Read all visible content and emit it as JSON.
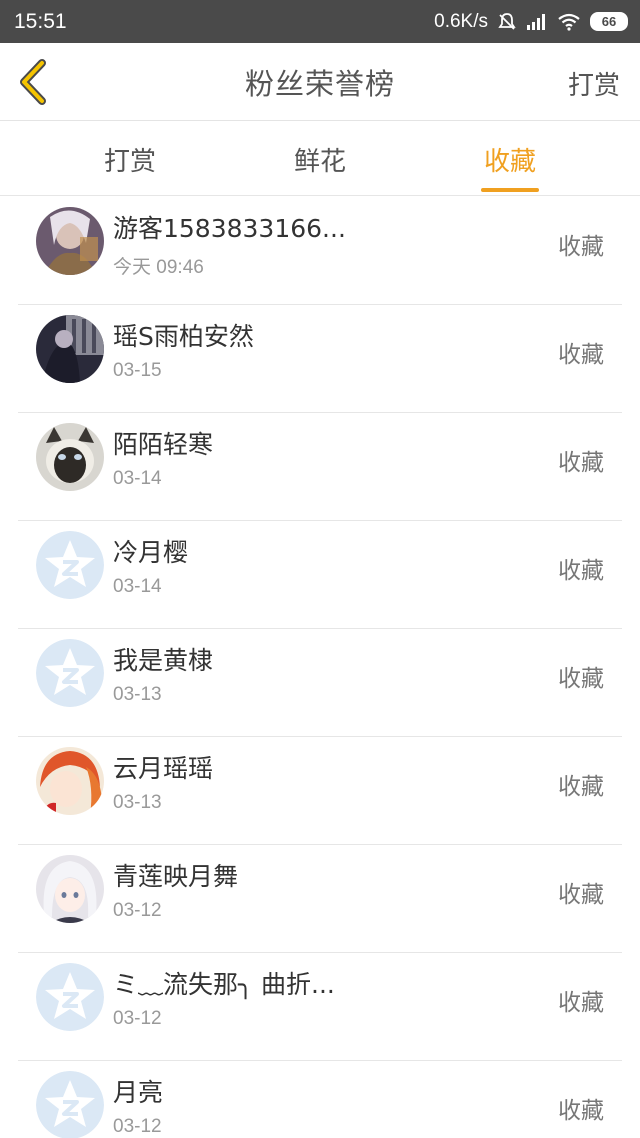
{
  "status_bar": {
    "time": "15:51",
    "network_speed": "0.6K/s",
    "battery": "66",
    "icons": [
      "mute-bell-icon",
      "signal-icon",
      "wifi-icon",
      "battery-icon"
    ]
  },
  "nav": {
    "title": "粉丝荣誉榜",
    "action_label": "打赏",
    "back_icon": "chevron-left-icon"
  },
  "tabs": [
    {
      "label": "打赏",
      "active": false
    },
    {
      "label": "鲜花",
      "active": false
    },
    {
      "label": "收藏",
      "active": true
    }
  ],
  "colors": {
    "accent": "#f0a020",
    "status_bar": "#4a4a4a",
    "divider": "#e6e6e6",
    "default_avatar": "#dbe8f5"
  },
  "fans": [
    {
      "name": "游客1583833166...",
      "time": "今天 09:46",
      "action": "收藏",
      "avatar": "avatar-photo-1"
    },
    {
      "name": "瑶S雨柏安然",
      "time": "03-15",
      "action": "收藏",
      "avatar": "avatar-photo-2"
    },
    {
      "name": "陌陌轻寒",
      "time": "03-14",
      "action": "收藏",
      "avatar": "avatar-cat"
    },
    {
      "name": "冷月樱",
      "time": "03-14",
      "action": "收藏",
      "avatar": "default-avatar-icon"
    },
    {
      "name": "我是黄棣",
      "time": "03-13",
      "action": "收藏",
      "avatar": "default-avatar-icon"
    },
    {
      "name": "云月瑶瑶",
      "time": "03-13",
      "action": "收藏",
      "avatar": "avatar-photo-3"
    },
    {
      "name": "青莲映月舞",
      "time": "03-12",
      "action": "收藏",
      "avatar": "avatar-photo-4"
    },
    {
      "name": "ミ﹏流失那╮ 曲折...",
      "time": "03-12",
      "action": "收藏",
      "avatar": "default-avatar-icon"
    },
    {
      "name": "月亮",
      "time": "03-12",
      "action": "收藏",
      "avatar": "default-avatar-icon"
    }
  ]
}
